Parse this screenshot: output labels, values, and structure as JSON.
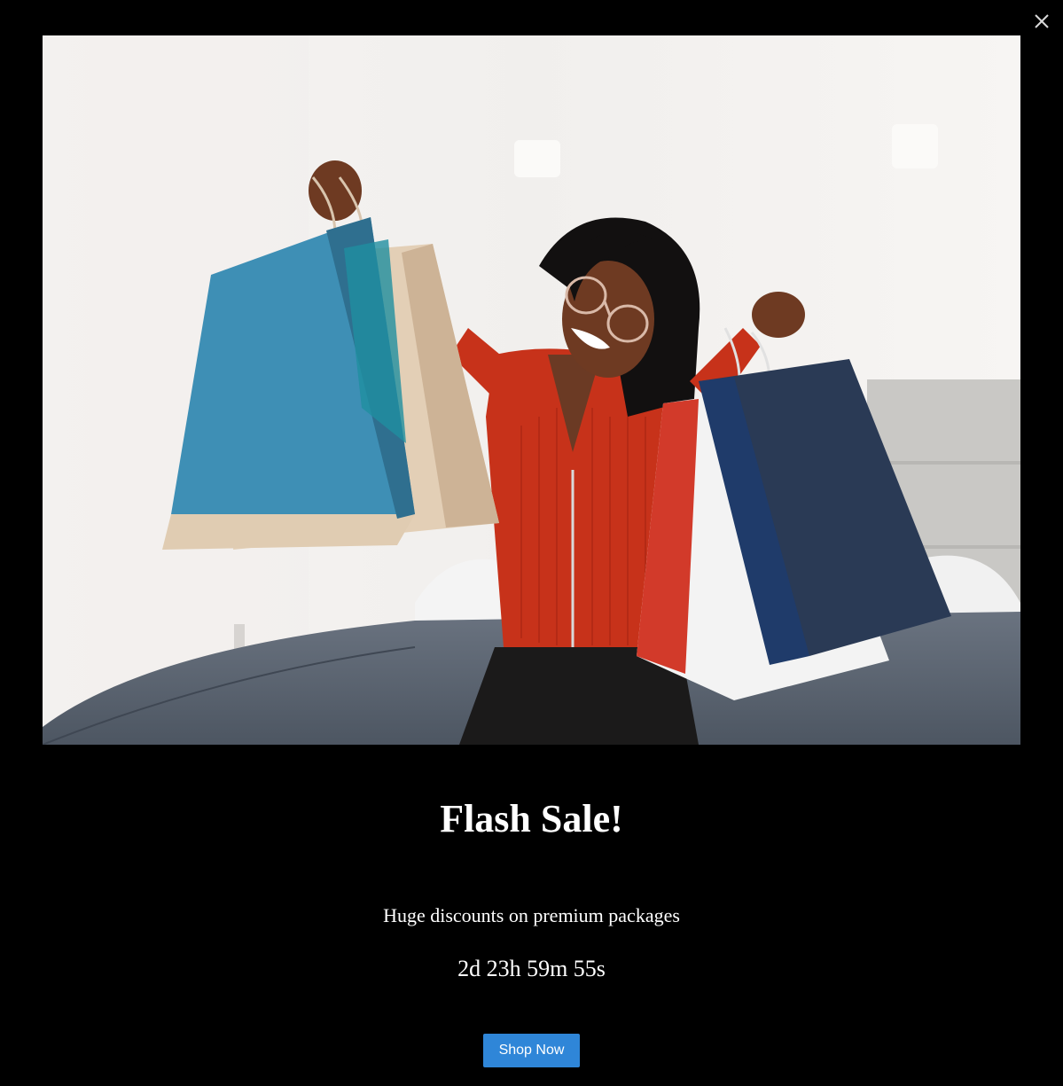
{
  "popup": {
    "close_icon": "close-icon",
    "hero_image": "woman-holding-shopping-bags-photo",
    "title": "Flash Sale!",
    "subtitle": "Huge discounts on premium packages",
    "countdown": "2d 23h 59m 55s",
    "cta_label": "Shop Now"
  },
  "colors": {
    "background": "#000000",
    "text": "#ffffff",
    "cta_background": "#2f86d8"
  }
}
